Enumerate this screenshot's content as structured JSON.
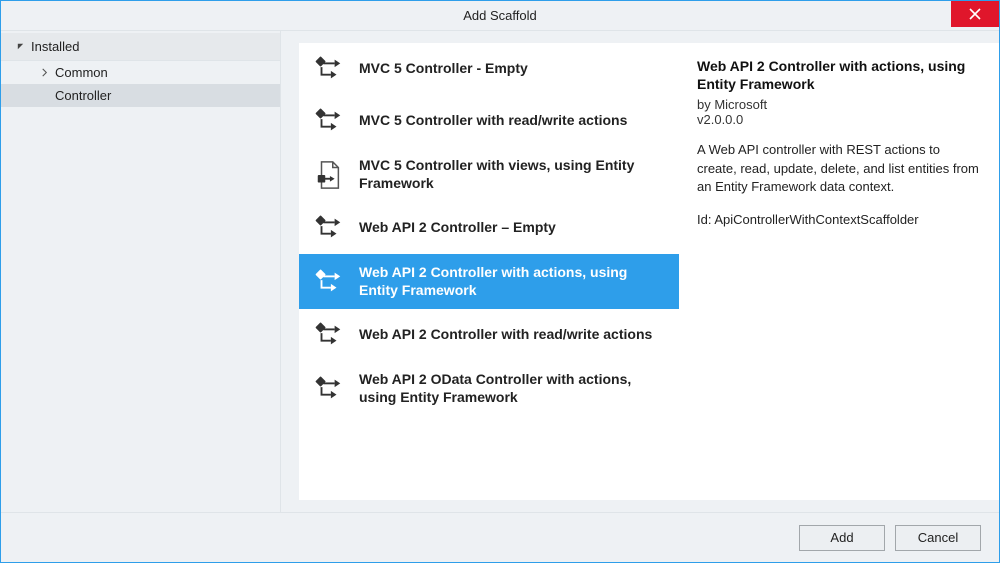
{
  "window": {
    "title": "Add Scaffold"
  },
  "sidebar": {
    "section": "Installed",
    "items": [
      {
        "label": "Common"
      },
      {
        "label": "Controller"
      }
    ],
    "selectedIndex": 1
  },
  "scaffolds": {
    "items": [
      {
        "label": "MVC 5 Controller - Empty",
        "icon": "controller"
      },
      {
        "label": "MVC 5 Controller with read/write actions",
        "icon": "controller"
      },
      {
        "label": "MVC 5 Controller with views, using Entity Framework",
        "icon": "document"
      },
      {
        "label": "Web API 2 Controller – Empty",
        "icon": "controller"
      },
      {
        "label": "Web API 2 Controller with actions, using Entity Framework",
        "icon": "controller"
      },
      {
        "label": "Web API 2 Controller with read/write actions",
        "icon": "controller"
      },
      {
        "label": "Web API 2 OData Controller with actions, using Entity Framework",
        "icon": "controller"
      }
    ],
    "selectedIndex": 4
  },
  "details": {
    "title": "Web API 2 Controller with actions, using Entity Framework",
    "by_prefix": "by ",
    "publisher": "Microsoft",
    "version": "v2.0.0.0",
    "description": "A Web API controller with REST actions to create, read, update, delete, and list entities from an Entity Framework data context.",
    "id_label": "Id: ",
    "id_value": "ApiControllerWithContextScaffolder"
  },
  "buttons": {
    "add": "Add",
    "cancel": "Cancel"
  }
}
